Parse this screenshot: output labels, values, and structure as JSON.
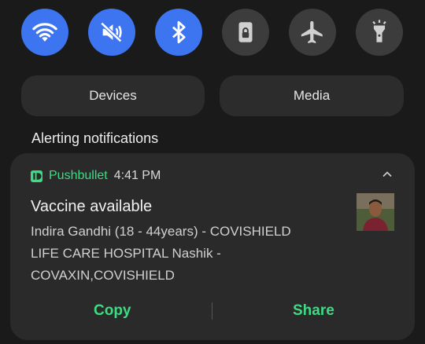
{
  "quick_settings": [
    {
      "name": "wifi",
      "icon": "wifi-icon",
      "state": "on"
    },
    {
      "name": "sound",
      "icon": "mute-icon",
      "state": "on"
    },
    {
      "name": "bluetooth",
      "icon": "bluetooth-icon",
      "state": "on"
    },
    {
      "name": "screen-lock",
      "icon": "rotation-lock-icon",
      "state": "off"
    },
    {
      "name": "airplane",
      "icon": "airplane-icon",
      "state": "off"
    },
    {
      "name": "flashlight",
      "icon": "flashlight-icon",
      "state": "off"
    }
  ],
  "pills": {
    "devices": "Devices",
    "media": "Media"
  },
  "section_label": "Alerting notifications",
  "notification": {
    "app": "Pushbullet",
    "time": "4:41 PM",
    "title": "Vaccine available",
    "lines": [
      "Indira Gandhi (18 - 44years) - COVISHIELD",
      "LIFE CARE HOSPITAL Nashik -",
      "COVAXIN,COVISHIELD"
    ],
    "actions": {
      "copy": "Copy",
      "share": "Share"
    }
  },
  "colors": {
    "accent_on": "#3d74f0",
    "tile_off": "#3c3c3c",
    "app_green": "#3ddc84",
    "background": "#1a1a1a",
    "card": "#2a2a2a"
  }
}
